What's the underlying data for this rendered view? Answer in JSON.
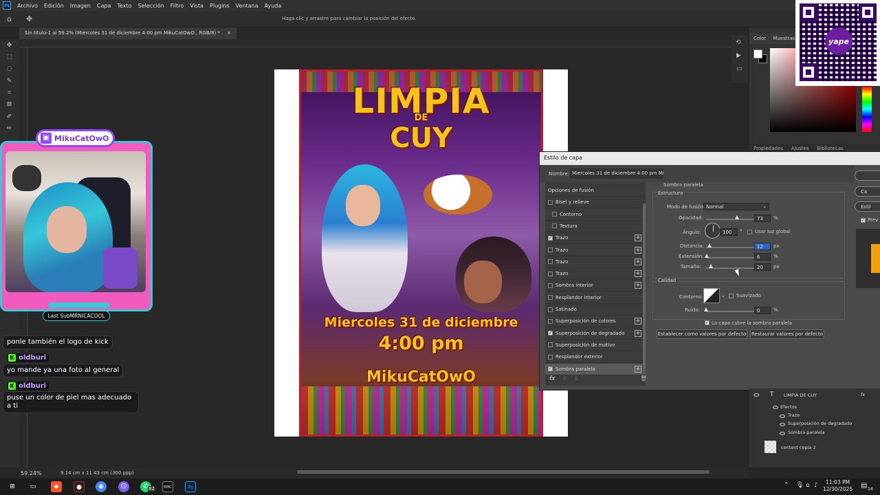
{
  "menubar": {
    "app_icon": "Ps",
    "items": [
      "Archivo",
      "Edición",
      "Imagen",
      "Capa",
      "Texto",
      "Selección",
      "Filtro",
      "Vista",
      "Plugins",
      "Ventana",
      "Ayuda"
    ]
  },
  "optionsbar": {
    "hint": "Haga clic y arrastre para cambiar la posición del efecto."
  },
  "document_tab": {
    "title": "Sin título-1 al 59.2% (Miercoles 31 de diciembre  4:00 pm  MikuCatOwO , RGB/8) *",
    "close": "×"
  },
  "status": {
    "zoom": "59.24%",
    "doc_size": "9.14 cm x 11.43 cm (300 ppp)"
  },
  "poster": {
    "title1": "LIMPIA",
    "title2": "DE",
    "title3": "CUY",
    "date": "Miercoles 31 de diciembre",
    "time": "4:00 pm",
    "name": "MikuCatOwO"
  },
  "color_panel": {
    "tabs": [
      "Color",
      "Muestras"
    ]
  },
  "properties_panel": {
    "tabs": [
      "Propiedades",
      "Ajustes",
      "Bibliotecas"
    ]
  },
  "qr": {
    "logo": "yape"
  },
  "dialog": {
    "title": "Estilo de capa",
    "name_label": "Nombre:",
    "name_value": "Miercoles 31 de diciembre  4:00 pm  MikuCat",
    "list": [
      {
        "label": "Opciones de fusión",
        "checkbox": false,
        "has_check": false,
        "plus": false,
        "indent": false
      },
      {
        "label": "Bisel y relieve",
        "checkbox": false,
        "has_check": true,
        "plus": false,
        "indent": false
      },
      {
        "label": "Contorno",
        "checkbox": false,
        "has_check": true,
        "plus": false,
        "indent": true
      },
      {
        "label": "Textura",
        "checkbox": false,
        "has_check": true,
        "plus": false,
        "indent": true
      },
      {
        "label": "Trazo",
        "checkbox": true,
        "has_check": true,
        "plus": true,
        "indent": false
      },
      {
        "label": "Trazo",
        "checkbox": false,
        "has_check": true,
        "plus": true,
        "indent": false
      },
      {
        "label": "Trazo",
        "checkbox": false,
        "has_check": true,
        "plus": true,
        "indent": false
      },
      {
        "label": "Trazo",
        "checkbox": false,
        "has_check": true,
        "plus": true,
        "indent": false
      },
      {
        "label": "Sombra interior",
        "checkbox": false,
        "has_check": true,
        "plus": true,
        "indent": false
      },
      {
        "label": "Resplandor interior",
        "checkbox": false,
        "has_check": true,
        "plus": false,
        "indent": false
      },
      {
        "label": "Satinado",
        "checkbox": false,
        "has_check": true,
        "plus": false,
        "indent": false
      },
      {
        "label": "Superposición de colores",
        "checkbox": false,
        "has_check": true,
        "plus": true,
        "indent": false
      },
      {
        "label": "Superposición de degradado",
        "checkbox": true,
        "has_check": true,
        "plus": true,
        "indent": false
      },
      {
        "label": "Superposición de motivo",
        "checkbox": false,
        "has_check": true,
        "plus": false,
        "indent": false
      },
      {
        "label": "Resplandor exterior",
        "checkbox": false,
        "has_check": true,
        "plus": false,
        "indent": false
      },
      {
        "label": "Sombra paralela",
        "checkbox": true,
        "has_check": true,
        "plus": true,
        "indent": false,
        "selected": true
      }
    ],
    "fx": "fx",
    "section_title": "Sombra paralela",
    "estructura": "Estructura",
    "modo_label": "Modo de fusión:",
    "modo_value": "Normal",
    "swatch_color": "#f2a10c",
    "opacidad_label": "Opacidad:",
    "opacidad_value": "73",
    "pct": "%",
    "angulo_label": "Ángulo:",
    "angulo_value": "100",
    "deg": "°",
    "luz_global": "Usar luz global",
    "distancia_label": "Distancia:",
    "distancia_value": "12",
    "px": "px",
    "extension_label": "Extensión:",
    "extension_value": "6",
    "tamano_label": "Tamaño:",
    "tamano_value": "20",
    "calidad": "Calidad",
    "contorno_label": "Contorno:",
    "suavizado": "Suavizado",
    "ruido_label": "Ruido:",
    "ruido_value": "0",
    "capa_cubre": "La capa cubre la sombra paralela",
    "btn_default": "Establecer como valores por defecto",
    "btn_restore": "Restaurar valores por defecto",
    "side_ok": "",
    "side_cancel": "Ca",
    "side_style": "Estil",
    "side_preview": "Prev"
  },
  "layers": {
    "layer_name": "LIMPIA DE CUY",
    "fx": "fx",
    "effects_label": "Efectos",
    "effects": [
      "Trazo",
      "Superposición de degradado",
      "Sombra paralela"
    ],
    "layer2": "content copia 2"
  },
  "stream": {
    "twitch_name": "MikuCatOwO",
    "last_sub": "Last SubMRNICACOOL",
    "chat": [
      {
        "user": "",
        "message": "ponle también el logo de kick"
      },
      {
        "user": "oldburi",
        "message": "yo mande ya una foto al general"
      },
      {
        "user": "oldburi",
        "message": "puse un color de piel mas adecuado a ti"
      }
    ]
  },
  "taskbar": {
    "badge": "82",
    "epic": "EPIC",
    "ps": "Ps",
    "time": "11:03 PM",
    "date": "12/30/2025",
    "notif": "14"
  }
}
